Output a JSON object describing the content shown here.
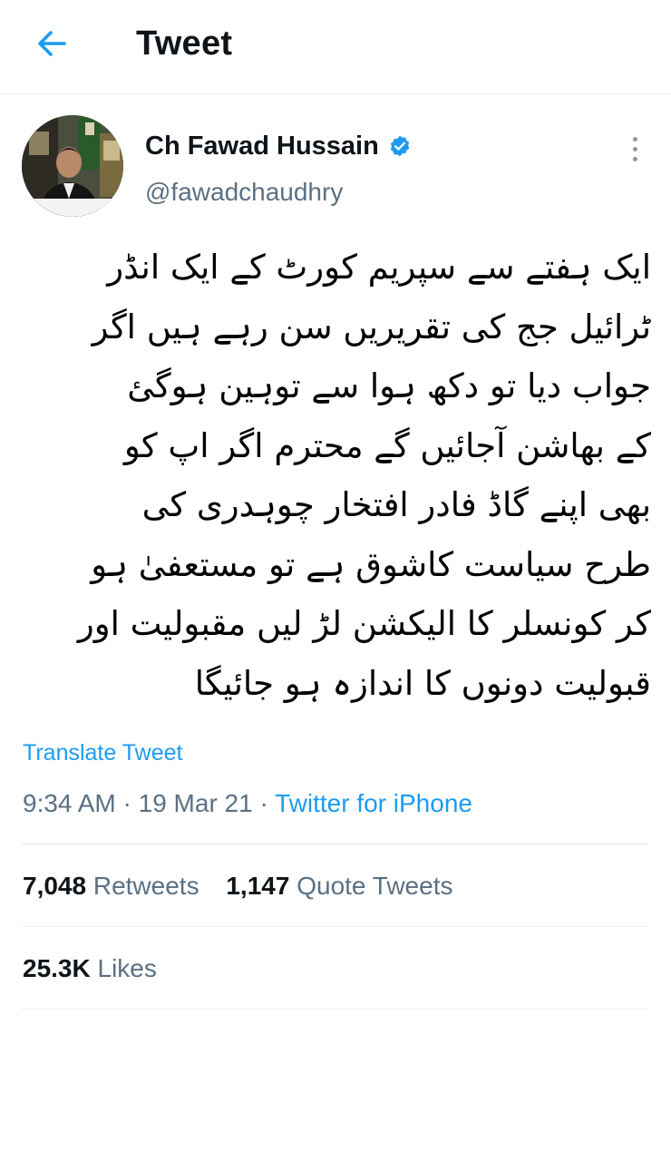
{
  "header": {
    "title": "Tweet"
  },
  "author": {
    "name": "Ch Fawad Hussain",
    "handle": "@fawadchaudhry",
    "verified": true
  },
  "tweet": {
    "lines": [
      "ایک ہفتے سے سپریم کورٹ کے ایک انڈر",
      "ٹرائیل جج کی تقریریں سن رہے ہیں اگر",
      "جواب دیا تو دکھ ہوا سے توہین ہوگئ",
      "کے بھاشن آجائیں گے محترم اگر اپ کو",
      "بھی اپنے گاڈ فادر افتخار چوہدری کی",
      "طرح سیاست کاشوق ہے تو مستعفیٰ ہو",
      "کر کونسلر کا الیکشن لڑ لیں مقبولیت اور",
      "قبولیت دونوں کا اندازہ ہو جائیگا"
    ],
    "translate_label": "Translate Tweet",
    "time": "9:34 AM",
    "date": "19 Mar 21",
    "source": "Twitter for iPhone"
  },
  "stats": {
    "retweets_count": "7,048",
    "retweets_label": "Retweets",
    "quotes_count": "1,147",
    "quotes_label": "Quote Tweets",
    "likes_count": "25.3K",
    "likes_label": "Likes"
  },
  "colors": {
    "accent": "#1d9bf0",
    "secondary_text": "#5b7083",
    "divider": "#e6ecf0"
  },
  "icons": {
    "back": "arrow-left-icon",
    "verified": "verified-badge-icon",
    "more": "more-vertical-icon"
  }
}
